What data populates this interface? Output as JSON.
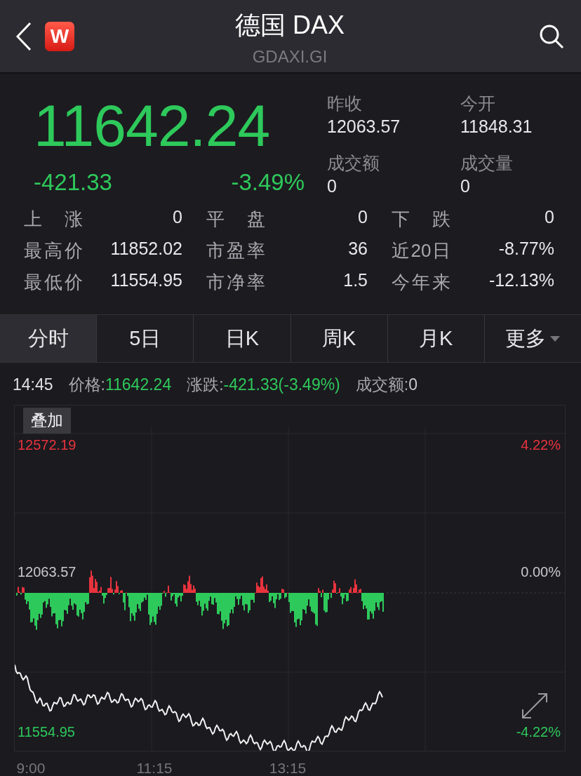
{
  "header": {
    "title": "德国 DAX",
    "subtitle": "GDAXI.GI",
    "logo": "W"
  },
  "quote": {
    "price": "11642.24",
    "change": "-421.33",
    "change_pct": "-3.49%",
    "color": "#2ec95b",
    "summary": [
      {
        "label": "昨收",
        "value": "12063.57"
      },
      {
        "label": "今开",
        "value": "11848.31"
      },
      {
        "label": "成交额",
        "value": "0"
      },
      {
        "label": "成交量",
        "value": "0"
      }
    ]
  },
  "stats": [
    {
      "label": "上涨",
      "value": "0"
    },
    {
      "label": "平盘",
      "value": "0"
    },
    {
      "label": "下跌",
      "value": "0"
    },
    {
      "label": "最高价",
      "value": "11852.02"
    },
    {
      "label": "市盈率",
      "value": "36"
    },
    {
      "label": "近20日",
      "value": "-8.77%"
    },
    {
      "label": "最低价",
      "value": "11554.95"
    },
    {
      "label": "市净率",
      "value": "1.5"
    },
    {
      "label": "今年来",
      "value": "-12.13%"
    }
  ],
  "tabs": [
    {
      "label": "分时",
      "selected": true,
      "kind": "tab"
    },
    {
      "label": "5日",
      "selected": false,
      "kind": "tab"
    },
    {
      "label": "日K",
      "selected": false,
      "kind": "tab"
    },
    {
      "label": "周K",
      "selected": false,
      "kind": "tab"
    },
    {
      "label": "月K",
      "selected": false,
      "kind": "tab"
    },
    {
      "label": "更多",
      "selected": false,
      "kind": "menu"
    }
  ],
  "info": {
    "time": "14:45",
    "items": [
      {
        "label": "价格:",
        "value": "11642.24",
        "color": "#2ec95b"
      },
      {
        "label": "涨跌:",
        "value": "-421.33(-3.49%)",
        "color": "#2ec95b"
      },
      {
        "label": "成交额:",
        "value": "0",
        "color": "#c9c9cc"
      }
    ]
  },
  "chart": {
    "overlay_button": "叠加",
    "high": "12572.19",
    "high_pct": "4.22%",
    "prev_close": "12063.57",
    "prev_pct": "0.00%",
    "low": "11554.95",
    "low_pct": "-4.22%",
    "x_labels": [
      "9:00",
      "11:15",
      "13:15"
    ]
  }
}
